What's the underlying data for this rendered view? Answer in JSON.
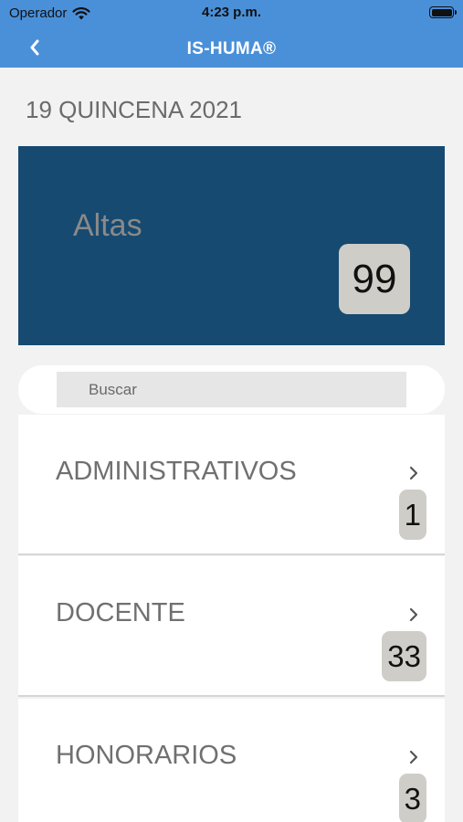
{
  "status_bar": {
    "carrier": "Operador",
    "time": "4:23 p.m."
  },
  "nav": {
    "title": "IS-HUMA®",
    "back_icon": "chevron-left-icon"
  },
  "period": "19 QUINCENA 2021",
  "summary": {
    "label": "Altas",
    "count": "99"
  },
  "search": {
    "placeholder": "Buscar",
    "value": ""
  },
  "categories": [
    {
      "label": "ADMINISTRATIVOS",
      "count": "1"
    },
    {
      "label": "DOCENTE",
      "count": "33"
    },
    {
      "label": "HONORARIOS",
      "count": "3"
    }
  ],
  "colors": {
    "header": "#4a90d9",
    "summary_card": "#164a70",
    "badge": "#cfcdc7",
    "background": "#f2f2f2"
  }
}
